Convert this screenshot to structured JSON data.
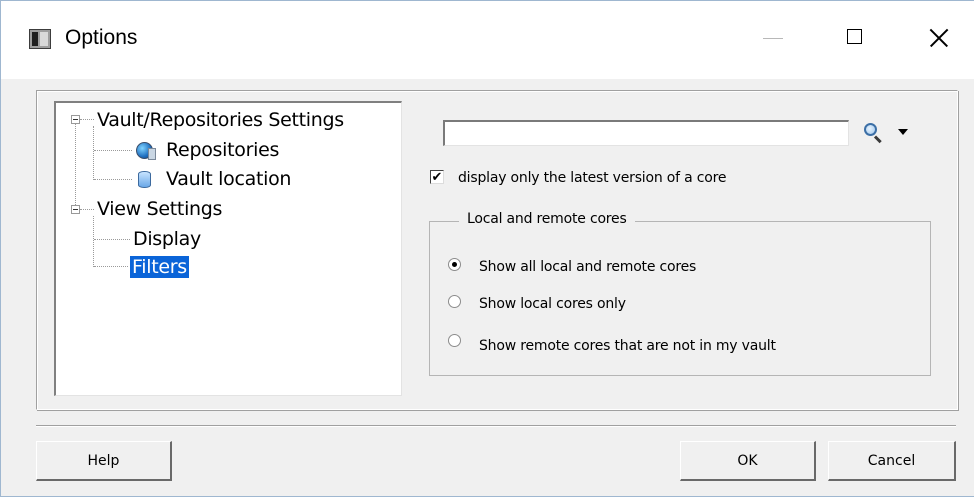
{
  "window": {
    "title": "Options",
    "controls": [
      "minimize",
      "maximize",
      "close"
    ]
  },
  "tree": {
    "groups": [
      {
        "label": "Vault/Repositories Settings",
        "expanded": true,
        "children": [
          {
            "label": "Repositories",
            "icon": "globe-icon"
          },
          {
            "label": "Vault location",
            "icon": "database-icon"
          }
        ]
      },
      {
        "label": "View Settings",
        "expanded": true,
        "children": [
          {
            "label": "Display"
          },
          {
            "label": "Filters",
            "selected": true
          }
        ]
      }
    ]
  },
  "filters": {
    "search_value": "",
    "latest_version_checkbox": {
      "label": "display only the latest version of a core",
      "checked": true
    },
    "cores_group": {
      "title": "Local and remote cores",
      "options": [
        {
          "label": "Show all local and remote cores",
          "selected": true
        },
        {
          "label": "Show local cores only",
          "selected": false
        },
        {
          "label": "Show remote cores that are not in my vault",
          "selected": false
        }
      ]
    }
  },
  "buttons": {
    "help": "Help",
    "ok": "OK",
    "cancel": "Cancel"
  },
  "colors": {
    "selection": "#0a64d8",
    "dialog_bg": "#f0f0f0"
  }
}
